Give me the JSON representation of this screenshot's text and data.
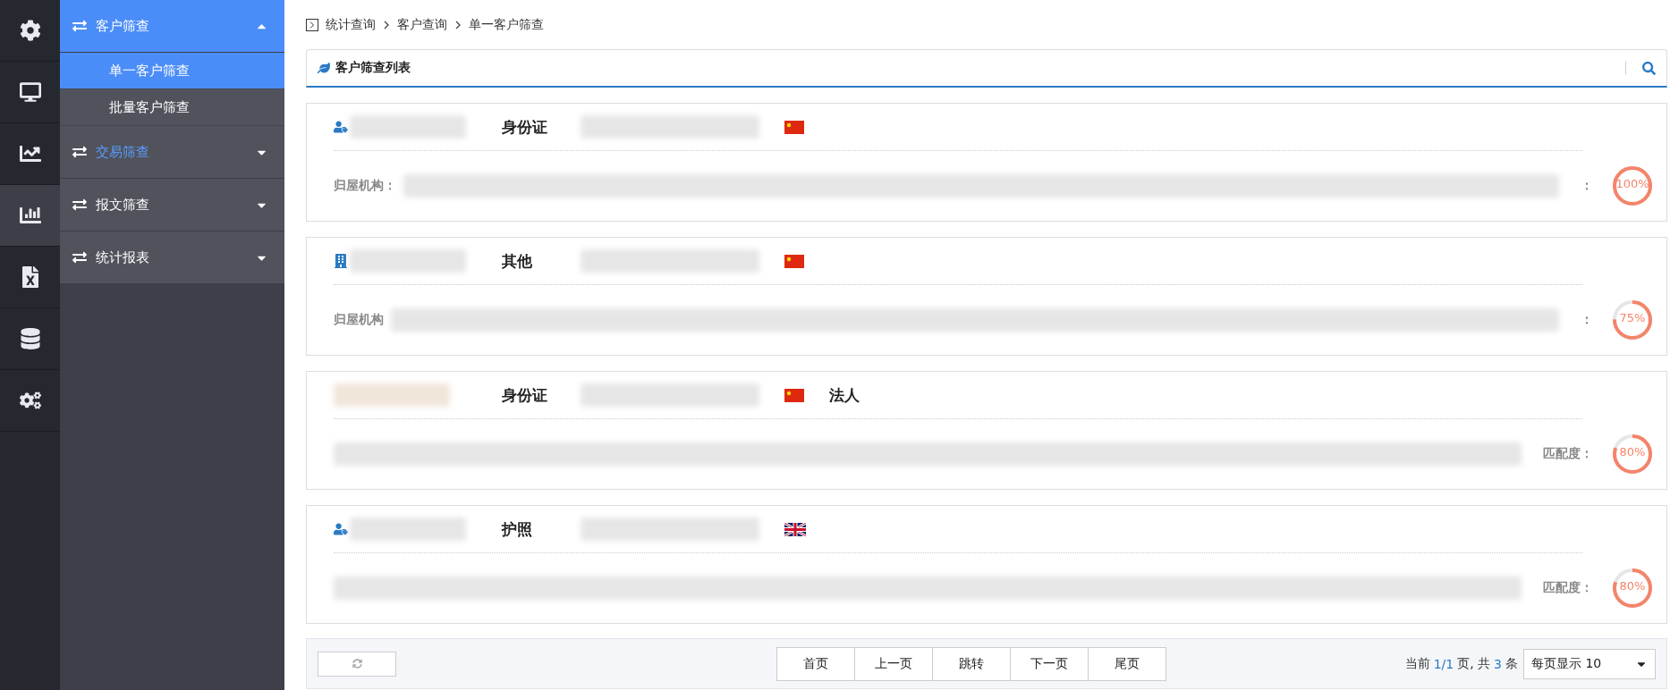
{
  "icon_rail": [
    {
      "selected": false
    },
    {
      "selected": false
    },
    {
      "selected": false
    },
    {
      "selected": true
    },
    {
      "selected": false
    },
    {
      "selected": false
    },
    {
      "selected": false
    }
  ],
  "menu": [
    {
      "label": "客户筛查",
      "expanded": true,
      "highlighted": false,
      "children": [
        {
          "label": "单一客户筛查",
          "selected": true
        },
        {
          "label": "批量客户筛查",
          "selected": false
        }
      ]
    },
    {
      "label": "交易筛查",
      "expanded": false,
      "highlighted": true
    },
    {
      "label": "报文筛查",
      "expanded": false,
      "highlighted": false
    },
    {
      "label": "统计报表",
      "expanded": false,
      "highlighted": false
    }
  ],
  "breadcrumb": [
    "统计查询",
    "客户查询",
    "单一客户筛查"
  ],
  "panel": {
    "title": "客户筛查列表"
  },
  "customers": [
    {
      "kind": "person",
      "id_type": "身份证",
      "detail_label": "归屋机构：",
      "match_label": "：",
      "match": "100%",
      "level": 1.0
    },
    {
      "kind": "organization",
      "id_type": "其他",
      "detail_label": "归屋机构",
      "match_label": "：",
      "match": "75%",
      "level": 0.75
    },
    {
      "kind": "legal",
      "id_type": "身份证",
      "entity": "法人",
      "match_label": "匹配度：",
      "match": "80%",
      "level": 0.8
    },
    {
      "kind": "person",
      "id_type": "护照",
      "match_label": "匹配度：",
      "match": "80%",
      "level": 0.8
    }
  ],
  "pagination": {
    "buttons": [
      "首页",
      "上一页",
      "跳转",
      "下一页",
      "尾页"
    ],
    "current_prefix": "当前",
    "current": "1/1",
    "mid": "页, 共",
    "total": "3",
    "suffix": "条",
    "page_size": "每页显示 10"
  }
}
